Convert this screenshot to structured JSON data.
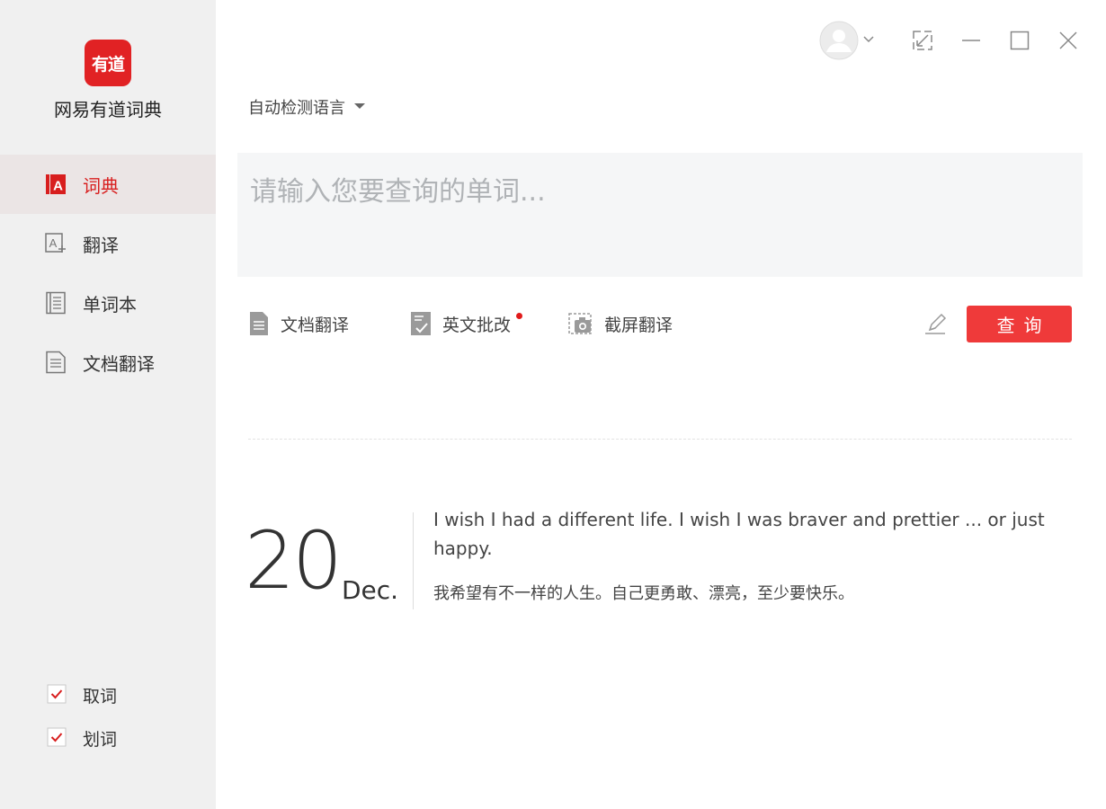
{
  "app": {
    "name": "网易有道词典",
    "logo_text": "有道",
    "brand_color": "#e12224"
  },
  "sidebar": {
    "items": [
      {
        "label": "词典",
        "icon": "dictionary-icon",
        "active": true
      },
      {
        "label": "翻译",
        "icon": "translate-icon",
        "active": false
      },
      {
        "label": "单词本",
        "icon": "wordbook-icon",
        "active": false
      },
      {
        "label": "文档翻译",
        "icon": "document-icon",
        "active": false
      }
    ],
    "options": [
      {
        "label": "取词",
        "checked": true
      },
      {
        "label": "划词",
        "checked": true
      }
    ]
  },
  "window_controls": [
    "avatar",
    "mini-mode-icon",
    "minimize-icon",
    "maximize-icon",
    "close-icon"
  ],
  "search": {
    "language": "自动检测语言",
    "placeholder": "请输入您要查询的单词...",
    "value": ""
  },
  "tools": [
    {
      "label": "文档翻译",
      "icon": "document-translate-icon",
      "has_dot": false
    },
    {
      "label": "英文批改",
      "icon": "essay-correct-icon",
      "has_dot": true
    },
    {
      "label": "截屏翻译",
      "icon": "screenshot-translate-icon",
      "has_dot": false
    }
  ],
  "query_button": "查询",
  "daily": {
    "day": "20",
    "month": "Dec.",
    "quote_en": "I wish I had a different life. I wish I was braver and prettier ... or just happy.",
    "quote_cn": "我希望有不一样的人生。自己更勇敢、漂亮，至少要快乐。"
  }
}
